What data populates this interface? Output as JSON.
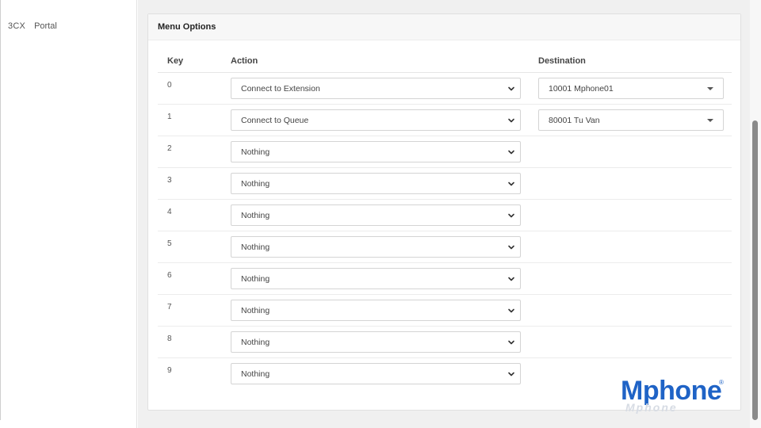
{
  "sidebar": {
    "logo": "3CX",
    "portal": "Portal"
  },
  "panel": {
    "title": "Menu Options",
    "columns": {
      "key": "Key",
      "action": "Action",
      "destination": "Destination"
    },
    "rows": [
      {
        "key": "0",
        "action": "Connect to Extension",
        "destination": "10001 Mphone01"
      },
      {
        "key": "1",
        "action": "Connect to Queue",
        "destination": "80001 Tu Van"
      },
      {
        "key": "2",
        "action": "Nothing",
        "destination": ""
      },
      {
        "key": "3",
        "action": "Nothing",
        "destination": ""
      },
      {
        "key": "4",
        "action": "Nothing",
        "destination": ""
      },
      {
        "key": "5",
        "action": "Nothing",
        "destination": ""
      },
      {
        "key": "6",
        "action": "Nothing",
        "destination": ""
      },
      {
        "key": "7",
        "action": "Nothing",
        "destination": ""
      },
      {
        "key": "8",
        "action": "Nothing",
        "destination": ""
      },
      {
        "key": "9",
        "action": "Nothing",
        "destination": ""
      }
    ]
  },
  "watermark": {
    "text": "Mphone",
    "registered": "®",
    "reflection": "Mphone"
  },
  "icons": {
    "select_arrow": "chevron-down-icon",
    "dropdown_caret": "caret-down-icon"
  },
  "colors": {
    "brand_blue": "#1f63c6",
    "scrollbar_thumb": "#8a8a8a"
  }
}
